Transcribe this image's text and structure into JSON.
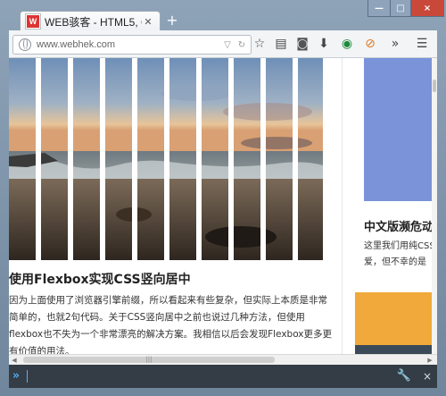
{
  "browser": {
    "tab_title": "WEB骇客 - HTML5, CSS3,...",
    "tab_favicon_letter": "W",
    "new_tab": "+",
    "url": "www.webhek.com",
    "window_buttons": [
      "—",
      "□",
      "×"
    ]
  },
  "toolbar_icons": [
    "star-icon",
    "reading-list-icon",
    "pocket-icon",
    "download-icon",
    "eye-icon",
    "addon-icon",
    "overflow-icon",
    "menu-icon"
  ],
  "article": {
    "title": "使用Flexbox实现CSS竖向居中",
    "body": "因为上面使用了浏览器引擎前缀，所以看起来有些复杂，但实际上本质是非常简单的，也就2句代码。关于CSS竖向居中之前也说过几种方法，但使用flexbox也不失为一个非常漂亮的解决方案。我相信以后会发现Flexbox更多更有价值的用法。"
  },
  "sidebar": {
    "title": "中文版濒危动",
    "body_line1": "这里我们用纯CSS",
    "body_line2": "爱，但不幸的是"
  },
  "devtools": {
    "prompt": "»",
    "wrench": "🔧",
    "close": "×"
  },
  "scrollbar": {
    "thumb_grip": "|||",
    "left_arrow": "◀",
    "right_arrow": "▶"
  },
  "colors": {
    "sidebar_image_blue": "#7a93d9",
    "sidebar_image_orange": "#f0a93a",
    "devtools_bg": "#343c45",
    "accent_blue": "#4fb3ff"
  }
}
